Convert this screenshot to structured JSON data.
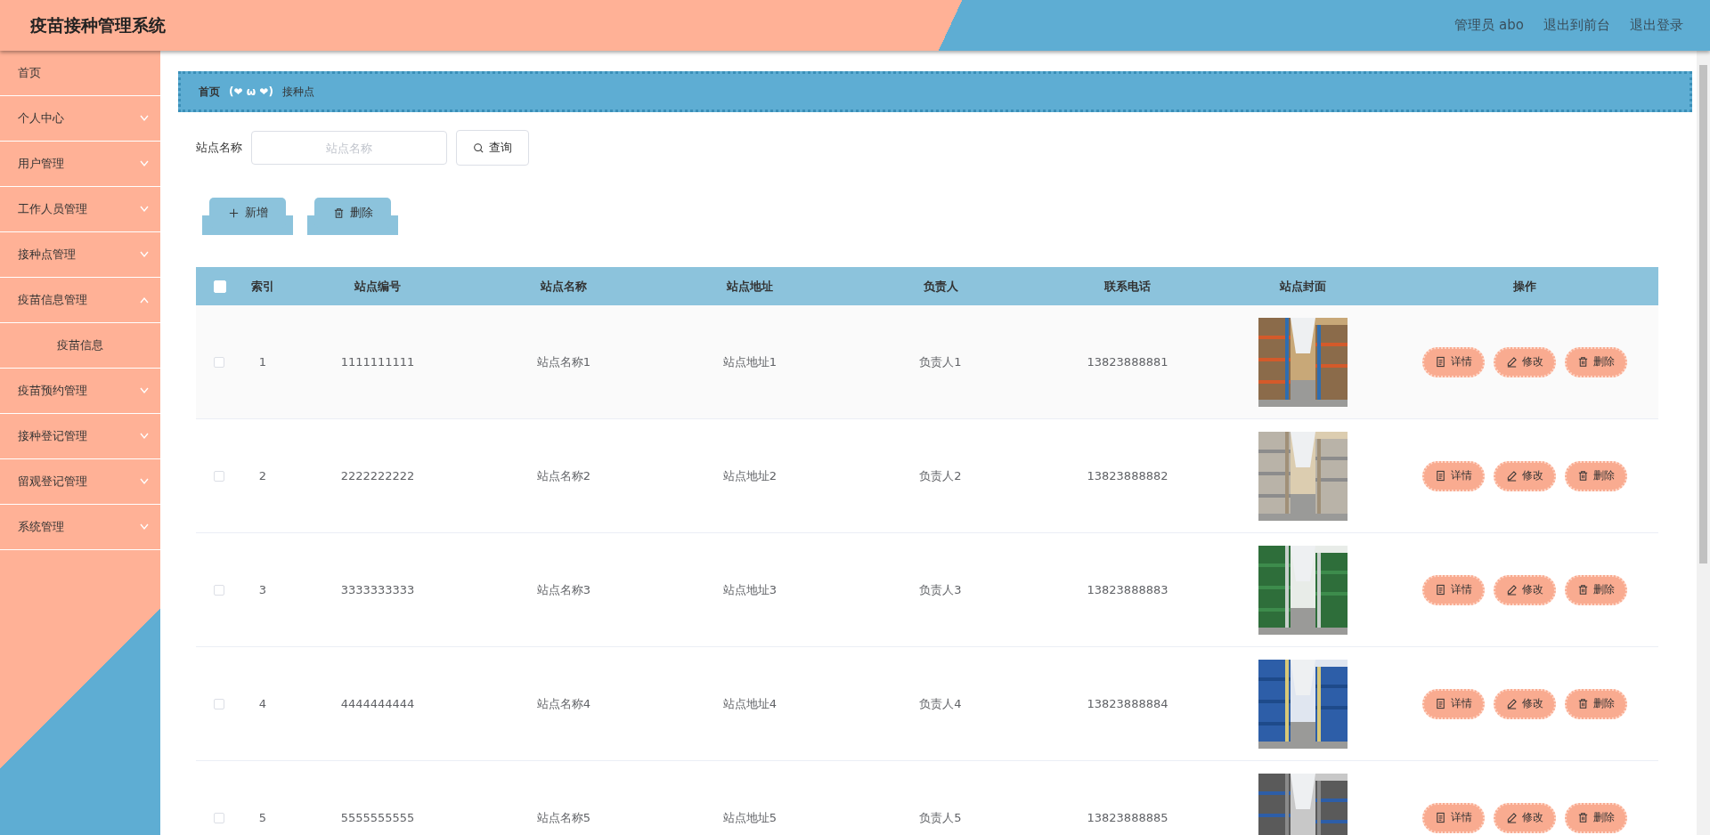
{
  "header": {
    "title": "疫苗接种管理系统",
    "user": "管理员 abo",
    "links": [
      "退出到前台",
      "退出登录"
    ]
  },
  "sidebar": {
    "items": [
      {
        "label": "首页",
        "kind": "link"
      },
      {
        "label": "个人中心",
        "kind": "menu",
        "expanded": false
      },
      {
        "label": "用户管理",
        "kind": "menu",
        "expanded": false
      },
      {
        "label": "工作人员管理",
        "kind": "menu",
        "expanded": false
      },
      {
        "label": "接种点管理",
        "kind": "menu",
        "expanded": false
      },
      {
        "label": "疫苗信息管理",
        "kind": "menu",
        "expanded": true,
        "children": [
          {
            "label": "疫苗信息"
          }
        ]
      },
      {
        "label": "疫苗预约管理",
        "kind": "menu",
        "expanded": false
      },
      {
        "label": "接种登记管理",
        "kind": "menu",
        "expanded": false
      },
      {
        "label": "留观登记管理",
        "kind": "menu",
        "expanded": false
      },
      {
        "label": "系统管理",
        "kind": "menu",
        "expanded": false
      }
    ]
  },
  "breadcrumb": {
    "items": [
      "首页",
      "接种点"
    ],
    "separator": "(❤ ω ❤)"
  },
  "search": {
    "label": "站点名称",
    "placeholder": "站点名称",
    "button": "查询"
  },
  "actions": [
    "新增",
    "删除"
  ],
  "table": {
    "select_all": {
      "checked": false
    },
    "columns": [
      "索引",
      "站点编号",
      "站点名称",
      "站点地址",
      "负责人",
      "联系电话",
      "站点封面",
      "操作"
    ],
    "rows": [
      {
        "checked": false,
        "cells": [
          "1",
          "1111111111",
          "站点名称1",
          "站点地址1",
          "负责人1",
          "13823888881"
        ],
        "buttons": [
          "详情",
          "修改",
          "删除"
        ]
      },
      {
        "checked": false,
        "cells": [
          "2",
          "2222222222",
          "站点名称2",
          "站点地址2",
          "负责人2",
          "13823888882"
        ],
        "buttons": [
          "详情",
          "修改",
          "删除"
        ]
      },
      {
        "checked": false,
        "cells": [
          "3",
          "3333333333",
          "站点名称3",
          "站点地址3",
          "负责人3",
          "13823888883"
        ],
        "buttons": [
          "详情",
          "修改",
          "删除"
        ]
      },
      {
        "checked": false,
        "cells": [
          "4",
          "4444444444",
          "站点名称4",
          "站点地址4",
          "负责人4",
          "13823888884"
        ],
        "buttons": [
          "详情",
          "修改",
          "删除"
        ]
      },
      {
        "checked": false,
        "cells": [
          "5",
          "5555555555",
          "站点名称5",
          "站点地址5",
          "负责人5",
          "13823888885"
        ],
        "buttons": [
          "详情",
          "修改",
          "删除"
        ]
      }
    ]
  }
}
